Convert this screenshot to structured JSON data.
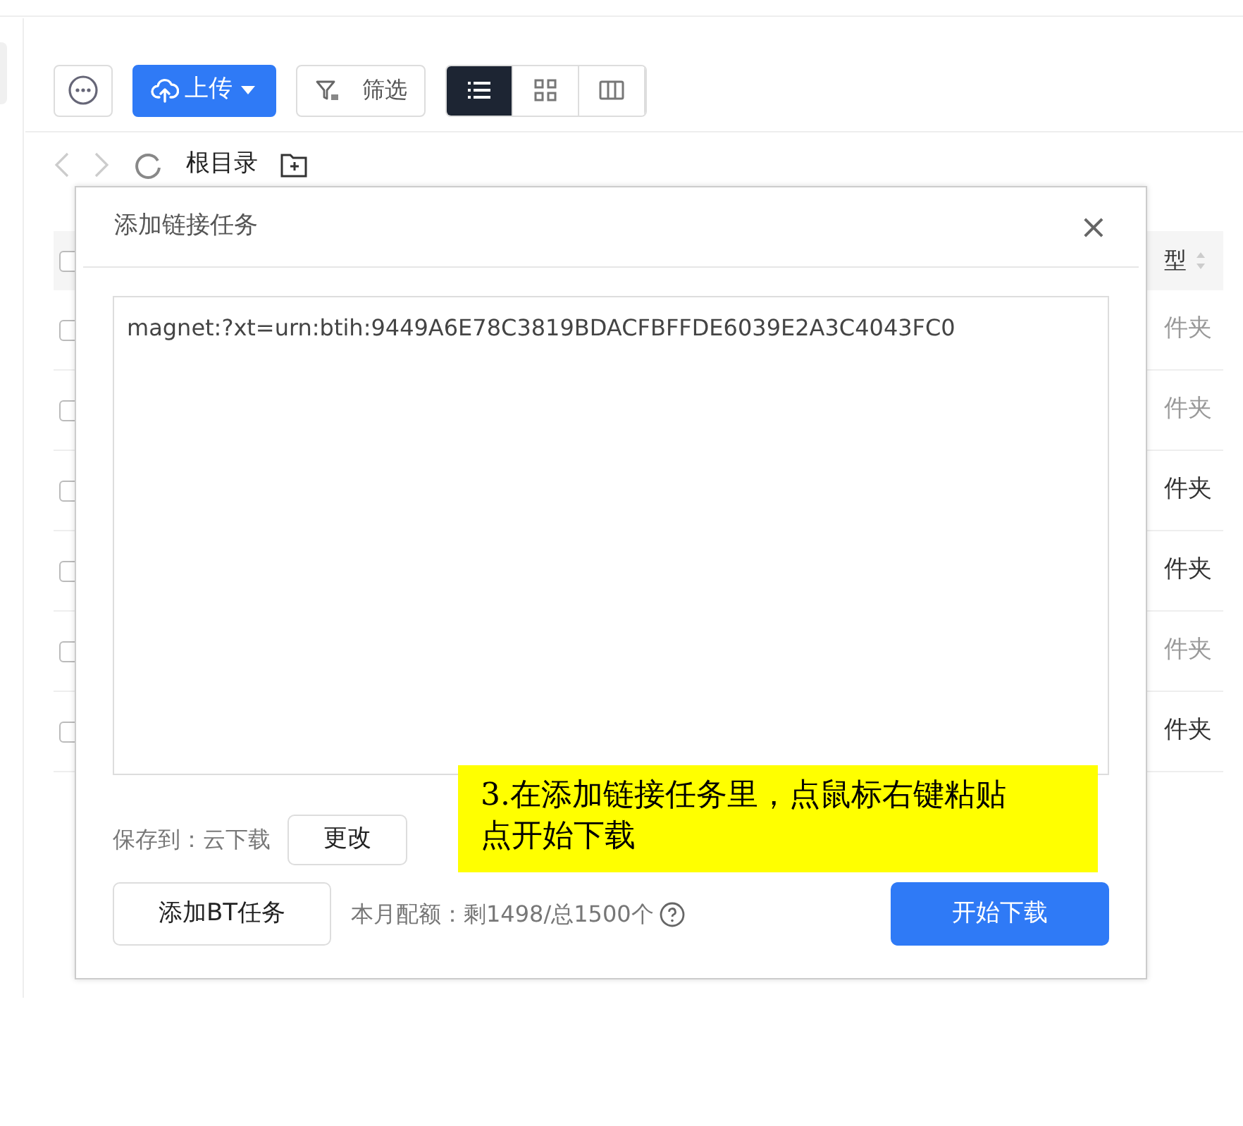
{
  "toolbar": {
    "upload_label": "上传",
    "filter_label": "筛选",
    "views": [
      {
        "kind": "list",
        "selected": true
      },
      {
        "kind": "grid",
        "selected": false
      },
      {
        "kind": "columns",
        "selected": false
      }
    ]
  },
  "breadcrumb": {
    "folder": "根目录"
  },
  "table": {
    "type_header": "型",
    "header_checked": false,
    "rows": [
      {
        "type": "件夹",
        "muted": true,
        "checked": false
      },
      {
        "type": "件夹",
        "muted": true,
        "checked": false
      },
      {
        "type": "件夹",
        "muted": false,
        "checked": false
      },
      {
        "type": "件夹",
        "muted": false,
        "checked": false
      },
      {
        "type": "件夹",
        "muted": true,
        "checked": false
      },
      {
        "type": "件夹",
        "muted": false,
        "checked": false
      }
    ]
  },
  "dialog": {
    "title": "添加链接任务",
    "close": "×",
    "link": "magnet:?xt=urn:btih:9449A6E78C3819BDACFBFFDE6039E2A3C4043FC0",
    "save_to_label": "保存到：云下载",
    "change_button": "更改",
    "bt_button": "添加BT任务",
    "quota": "本月配额：剩1498/总1500个",
    "start_button": "开始下载"
  },
  "annotation": "3.在添加链接任务里，点鼠标右键粘贴点开始下载"
}
